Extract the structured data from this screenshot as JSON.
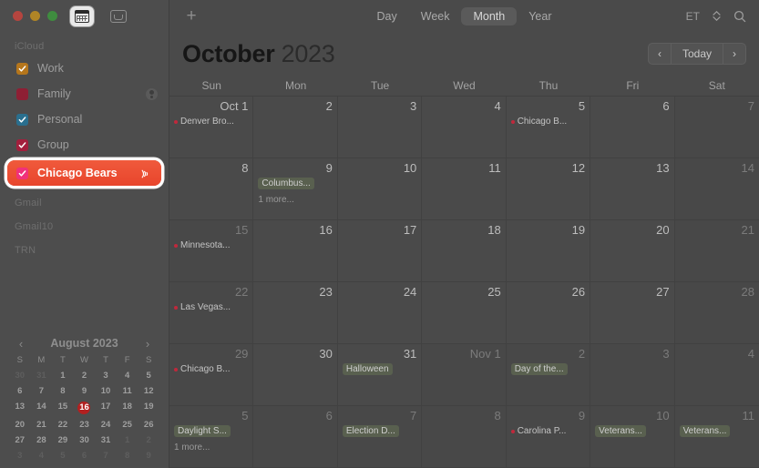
{
  "window": {
    "traffic_lights": [
      "close",
      "minimize",
      "zoom"
    ],
    "calendar_tab_icon": "calendar-icon",
    "inbox_tab_icon": "inbox-icon"
  },
  "sidebar": {
    "sections": [
      {
        "label": "iCloud",
        "calendars": [
          {
            "name": "Work",
            "color": "#b5761c",
            "checked": true,
            "shared": false,
            "selected": false
          },
          {
            "name": "Family",
            "color": "#8e1f34",
            "checked": false,
            "shared": true,
            "selected": false
          },
          {
            "name": "Personal",
            "color": "#2a6f8e",
            "checked": true,
            "shared": false,
            "selected": false
          },
          {
            "name": "Group",
            "color": "#a31f3d",
            "checked": true,
            "shared": false,
            "selected": false
          },
          {
            "name": "Chicago Bears",
            "color": "#f0317a",
            "checked": true,
            "shared": false,
            "selected": true,
            "broadcast_icon": "broadcast-icon"
          }
        ]
      },
      {
        "label": "Gmail",
        "calendars": []
      },
      {
        "label": "Gmail10",
        "calendars": []
      },
      {
        "label": "TRN",
        "calendars": []
      }
    ],
    "mini_calendar": {
      "title": "August 2023",
      "prev_icon": "chevron-left-icon",
      "next_icon": "chevron-right-icon",
      "dow": [
        "S",
        "M",
        "T",
        "W",
        "T",
        "F",
        "S"
      ],
      "today": 16,
      "weeks": [
        [
          {
            "d": 30,
            "out": true
          },
          {
            "d": 31,
            "out": true
          },
          {
            "d": 1
          },
          {
            "d": 2
          },
          {
            "d": 3
          },
          {
            "d": 4
          },
          {
            "d": 5
          }
        ],
        [
          {
            "d": 6
          },
          {
            "d": 7
          },
          {
            "d": 8
          },
          {
            "d": 9
          },
          {
            "d": 10
          },
          {
            "d": 11
          },
          {
            "d": 12
          }
        ],
        [
          {
            "d": 13
          },
          {
            "d": 14
          },
          {
            "d": 15
          },
          {
            "d": 16,
            "today": true
          },
          {
            "d": 17
          },
          {
            "d": 18
          },
          {
            "d": 19
          }
        ],
        [
          {
            "d": 20
          },
          {
            "d": 21
          },
          {
            "d": 22
          },
          {
            "d": 23
          },
          {
            "d": 24
          },
          {
            "d": 25
          },
          {
            "d": 26
          }
        ],
        [
          {
            "d": 27
          },
          {
            "d": 28
          },
          {
            "d": 29
          },
          {
            "d": 30
          },
          {
            "d": 31
          },
          {
            "d": 1,
            "out": true
          },
          {
            "d": 2,
            "out": true
          }
        ],
        [
          {
            "d": 3,
            "out": true
          },
          {
            "d": 4,
            "out": true
          },
          {
            "d": 5,
            "out": true
          },
          {
            "d": 6,
            "out": true
          },
          {
            "d": 7,
            "out": true
          },
          {
            "d": 8,
            "out": true
          },
          {
            "d": 9,
            "out": true
          }
        ]
      ]
    }
  },
  "toolbar": {
    "add_label": "+",
    "views": [
      "Day",
      "Week",
      "Month",
      "Year"
    ],
    "selected_view": "Month",
    "timezone": "ET",
    "stepper_icon": "stepper-icon",
    "search_icon": "search-icon"
  },
  "header": {
    "month": "October",
    "year": "2023",
    "prev_label": "‹",
    "today_label": "Today",
    "next_label": "›"
  },
  "calendar": {
    "day_headers": [
      "Sun",
      "Mon",
      "Tue",
      "Wed",
      "Thu",
      "Fri",
      "Sat"
    ],
    "weeks": [
      [
        {
          "label": "Oct 1",
          "out": false,
          "events": [
            {
              "title": "Denver Bro...",
              "style": "dot",
              "color": "#c0283c"
            }
          ]
        },
        {
          "label": "2",
          "out": false,
          "events": []
        },
        {
          "label": "3",
          "out": false,
          "events": []
        },
        {
          "label": "4",
          "out": false,
          "events": []
        },
        {
          "label": "5",
          "out": false,
          "events": [
            {
              "title": "Chicago B...",
              "style": "dot",
              "color": "#c0283c"
            }
          ]
        },
        {
          "label": "6",
          "out": false,
          "events": []
        },
        {
          "label": "7",
          "out": true,
          "events": []
        }
      ],
      [
        {
          "label": "8",
          "out": false,
          "events": []
        },
        {
          "label": "9",
          "out": false,
          "events": [
            {
              "title": "Columbus...",
              "style": "badge"
            }
          ],
          "more": "1 more..."
        },
        {
          "label": "10",
          "out": false,
          "events": []
        },
        {
          "label": "11",
          "out": false,
          "events": []
        },
        {
          "label": "12",
          "out": false,
          "events": []
        },
        {
          "label": "13",
          "out": false,
          "events": []
        },
        {
          "label": "14",
          "out": true,
          "events": []
        }
      ],
      [
        {
          "label": "15",
          "out": true,
          "events": [
            {
              "title": "Minnesota...",
              "style": "dot",
              "color": "#c0283c"
            }
          ]
        },
        {
          "label": "16",
          "out": false,
          "events": []
        },
        {
          "label": "17",
          "out": false,
          "events": []
        },
        {
          "label": "18",
          "out": false,
          "events": []
        },
        {
          "label": "19",
          "out": false,
          "events": []
        },
        {
          "label": "20",
          "out": false,
          "events": []
        },
        {
          "label": "21",
          "out": true,
          "events": []
        }
      ],
      [
        {
          "label": "22",
          "out": true,
          "events": [
            {
              "title": "Las Vegas...",
              "style": "dot",
              "color": "#c0283c"
            }
          ]
        },
        {
          "label": "23",
          "out": false,
          "events": []
        },
        {
          "label": "24",
          "out": false,
          "events": []
        },
        {
          "label": "25",
          "out": false,
          "events": []
        },
        {
          "label": "26",
          "out": false,
          "events": []
        },
        {
          "label": "27",
          "out": false,
          "events": []
        },
        {
          "label": "28",
          "out": true,
          "events": []
        }
      ],
      [
        {
          "label": "29",
          "out": true,
          "events": [
            {
              "title": "Chicago B...",
              "style": "dot",
              "color": "#c0283c"
            }
          ]
        },
        {
          "label": "30",
          "out": false,
          "events": []
        },
        {
          "label": "31",
          "out": false,
          "events": [
            {
              "title": "Halloween",
              "style": "badge"
            }
          ]
        },
        {
          "label": "Nov 1",
          "out": true,
          "events": []
        },
        {
          "label": "2",
          "out": true,
          "events": [
            {
              "title": "Day of the...",
              "style": "badge"
            }
          ]
        },
        {
          "label": "3",
          "out": true,
          "events": []
        },
        {
          "label": "4",
          "out": true,
          "events": []
        }
      ],
      [
        {
          "label": "5",
          "out": true,
          "events": [
            {
              "title": "Daylight S...",
              "style": "badge"
            }
          ],
          "more": "1 more..."
        },
        {
          "label": "6",
          "out": true,
          "events": []
        },
        {
          "label": "7",
          "out": true,
          "events": [
            {
              "title": "Election D...",
              "style": "badge"
            }
          ]
        },
        {
          "label": "8",
          "out": true,
          "events": []
        },
        {
          "label": "9",
          "out": true,
          "events": [
            {
              "title": "Carolina P...",
              "style": "dot",
              "color": "#c0283c"
            }
          ]
        },
        {
          "label": "10",
          "out": true,
          "events": [
            {
              "title": "Veterans...",
              "style": "badge"
            }
          ]
        },
        {
          "label": "11",
          "out": true,
          "events": [
            {
              "title": "Veterans...",
              "style": "badge"
            }
          ]
        }
      ]
    ]
  }
}
